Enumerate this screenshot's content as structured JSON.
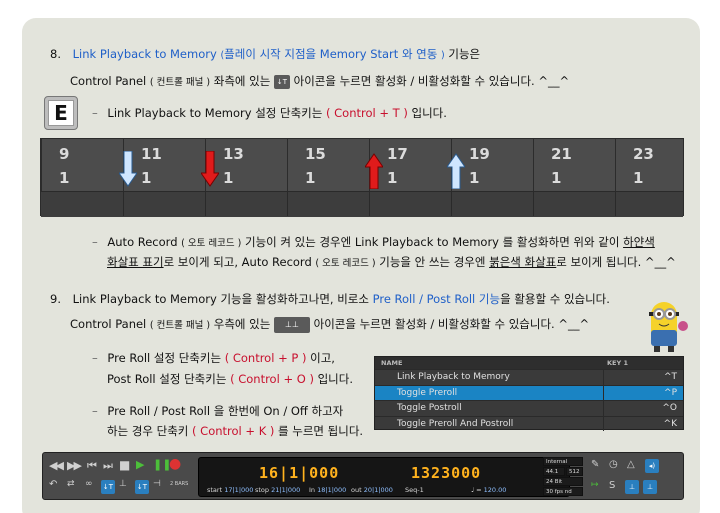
{
  "section8": {
    "num": "8.",
    "title": "Link Playback to Memory",
    "note_open": "(",
    "note": "플레이 시작 지점을 Memory Start 와 연동",
    "note_close": ")",
    "tail": "기능은",
    "line2_a": "Control Panel",
    "line2_b": "( 컨트롤 패널 )",
    "line2_c": "좌측에 있는",
    "line2_icon": "↓T",
    "line2_d": "아이콘을 누르면 활성화 / 비활성화할 수 있습니다. ^__^",
    "key_label": "E",
    "bullet1_a": "Link Playback to Memory 설정 단축키는",
    "bullet1_b": "( Control + T )",
    "bullet1_c": "입니다.",
    "bullet2_line1_a": "Auto Record",
    "bullet2_line1_b": "( 오토 레코드 )",
    "bullet2_line1_c": "기능이 켜 있는 경우엔 Link Playback to Memory 를 활성화하면 위와 같이",
    "bullet2_line1_d": "하얀색",
    "bullet2_line2_a": "화살표 표기",
    "bullet2_line2_b": "로 보이게 되고, Auto Record",
    "bullet2_line2_c": "( 오토 레코드 )",
    "bullet2_line2_d": "기능을 안 쓰는 경우엔",
    "bullet2_line2_e": "붉은색 화살표",
    "bullet2_line2_f": "로 보이게 됩니다. ^__^"
  },
  "ruler": {
    "bars": [
      "9",
      "11",
      "13",
      "15",
      "17",
      "19",
      "21",
      "23"
    ],
    "beats": [
      "1",
      "1",
      "1",
      "1",
      "1",
      "1",
      "1",
      "1"
    ]
  },
  "section9": {
    "num": "9.",
    "line1_a": "Link Playback to Memory 기능을 활성화하고나면, 비로소",
    "line1_b": "Pre Roll / Post Roll 기능",
    "line1_c": "을 활용할 수 있습니다.",
    "line2_a": "Control Panel",
    "line2_b": "( 컨트롤 패널 )",
    "line2_c": "우측에 있는",
    "line2_icon": "⊥⊥",
    "line2_d": "아이콘을 누르면 활성화 / 비활성화할 수 있습니다. ^__^",
    "b1_l1_a": "Pre Roll 설정 단축키는",
    "b1_l1_b": "( Control + P )",
    "b1_l1_c": "이고,",
    "b1_l2_a": "Post Roll 설정 단축키는",
    "b1_l2_b": "( Control + O )",
    "b1_l2_c": "입니다.",
    "b2_l1": "Pre Roll / Post Roll 을 한번에 On / Off 하고자",
    "b2_l2_a": "하는 경우 단축키",
    "b2_l2_b": "( Control + K )",
    "b2_l2_c": "를 누르면 됩니다."
  },
  "shortcuts": {
    "col_name": "NAME",
    "col_key": "KEY 1",
    "rows": [
      {
        "name": "Link Playback to Memory",
        "key": "^T"
      },
      {
        "name": "Toggle Preroll",
        "key": "^P"
      },
      {
        "name": "Toggle Postroll",
        "key": "^O"
      },
      {
        "name": "Toggle Preroll And Postroll",
        "key": "^K"
      }
    ]
  },
  "transport": {
    "main_position": "16|1|000",
    "secondary_position": "1323000",
    "start_label": "start",
    "start_value": "17|1|000",
    "stop_label": "stop",
    "stop_value": "21|1|000",
    "in_label": "In",
    "in_value": "18|1|000",
    "out_label": "out",
    "out_value": "20|1|000",
    "seq_label": "Seq-1",
    "tempo": "120.00",
    "bars_label": "2 BARS",
    "clock": "Internal Clock",
    "rate_a": "44.1 kHz",
    "rate_b": "512",
    "bitdepth": "24 Bit Integer",
    "fps": "30 fps nd"
  },
  "colors": {
    "accent_blue": "#1f5fc8",
    "accent_red": "#c8102e",
    "highlight_row": "#1a84c4",
    "lcd_orange": "#ffb21e"
  }
}
